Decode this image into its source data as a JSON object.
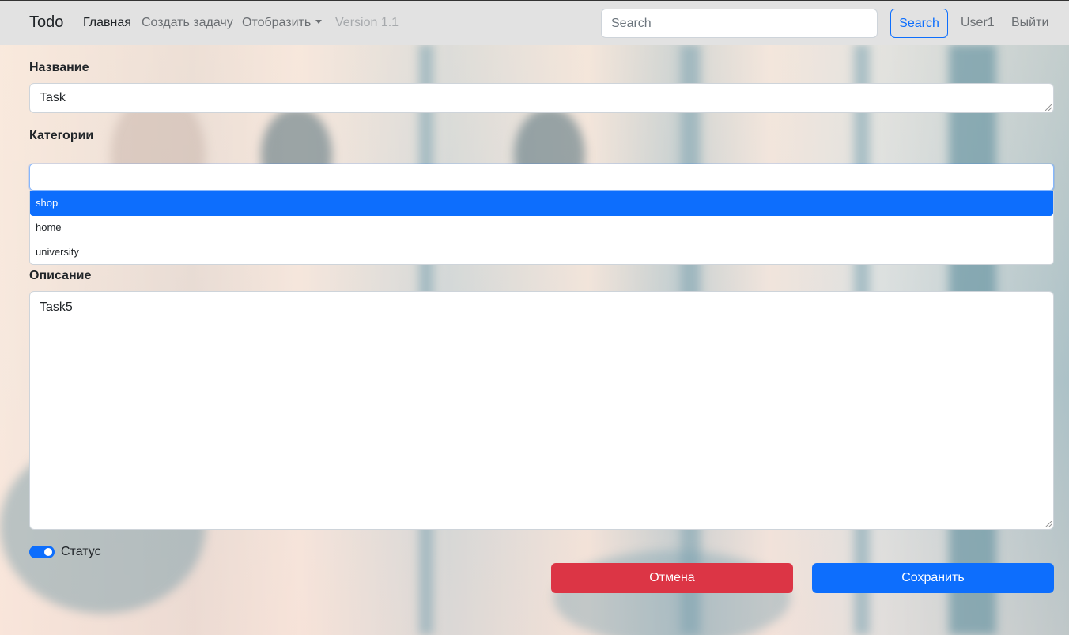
{
  "nav": {
    "brand": "Todo",
    "links": {
      "home": "Главная",
      "create_task": "Создать задачу",
      "display": "Отобразить",
      "version": "Version 1.1"
    },
    "search_placeholder": "Search",
    "search_button": "Search",
    "user": "User1",
    "logout": "Выйти"
  },
  "form": {
    "name_label": "Название",
    "name_value": "Task",
    "categories_label": "Категории",
    "categories_value": "",
    "category_options": [
      "shop",
      "home",
      "university"
    ],
    "selected_option": "shop",
    "description_label": "Описание",
    "description_value": "Task5",
    "status_label": "Статус",
    "status_on": true,
    "cancel_button": "Отмена",
    "save_button": "Сохранить"
  },
  "colors": {
    "primary": "#0d6efd",
    "danger": "#dc3545",
    "navbar_bg": "#e2e2e2"
  }
}
